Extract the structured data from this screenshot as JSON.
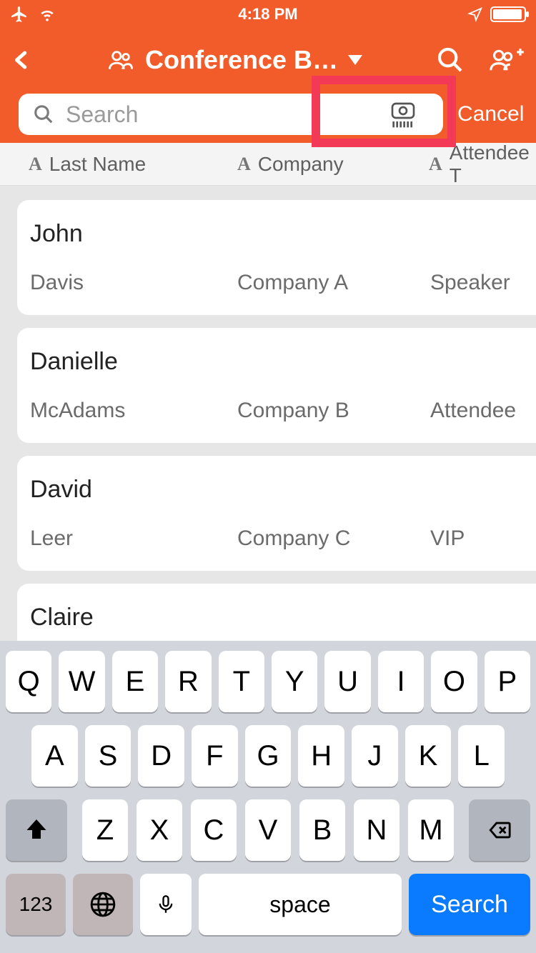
{
  "status": {
    "time": "4:18 PM"
  },
  "nav": {
    "title": "Conference B…",
    "cancel": "Cancel"
  },
  "search": {
    "placeholder": "Search"
  },
  "columns": {
    "c1": "Last Name",
    "c2": "Company",
    "c3": "Attendee T"
  },
  "attendees": [
    {
      "first": "John",
      "last": "Davis",
      "company": "Company A",
      "type": "Speaker"
    },
    {
      "first": "Danielle",
      "last": "McAdams",
      "company": "Company B",
      "type": "Attendee"
    },
    {
      "first": "David",
      "last": "Leer",
      "company": "Company C",
      "type": "VIP"
    },
    {
      "first": "Claire",
      "last": "",
      "company": "",
      "type": ""
    }
  ],
  "keyboard": {
    "row1": [
      "Q",
      "W",
      "E",
      "R",
      "T",
      "Y",
      "U",
      "I",
      "O",
      "P"
    ],
    "row2": [
      "A",
      "S",
      "D",
      "F",
      "G",
      "H",
      "J",
      "K",
      "L"
    ],
    "row3": [
      "Z",
      "X",
      "C",
      "V",
      "B",
      "N",
      "M"
    ],
    "num": "123",
    "space": "space",
    "search": "Search"
  }
}
